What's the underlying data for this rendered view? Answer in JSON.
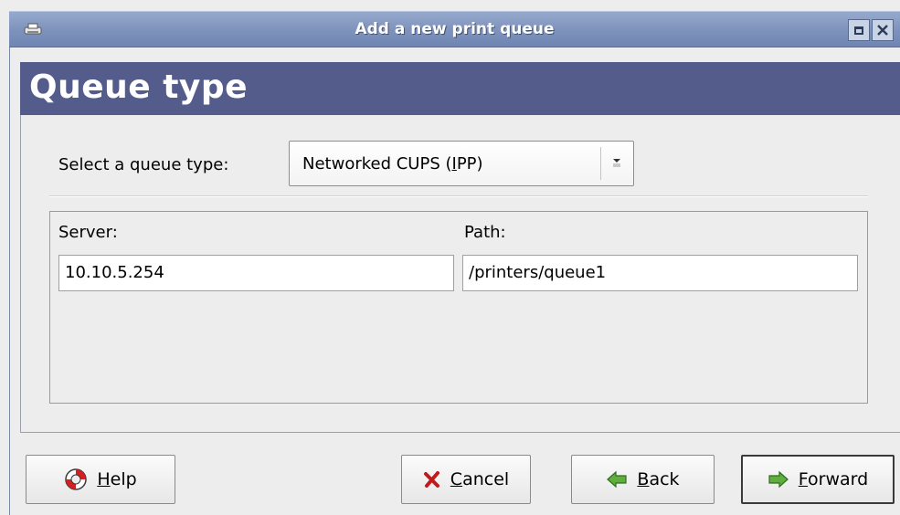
{
  "window": {
    "title": "Add a new print queue"
  },
  "header": {
    "title": "Queue type"
  },
  "queue_type": {
    "label": "Select a queue type:",
    "selected_prefix": "Networked CUPS (",
    "selected_mnemonic": "I",
    "selected_suffix": "PP)"
  },
  "server": {
    "label": "Server:",
    "value": "10.10.5.254"
  },
  "path": {
    "label": "Path:",
    "value": "/printers/queue1"
  },
  "buttons": {
    "help": {
      "mnemonic": "H",
      "rest": "elp"
    },
    "cancel": {
      "mnemonic": "C",
      "rest": "ancel"
    },
    "back": {
      "mnemonic": "B",
      "rest": "ack"
    },
    "forward": {
      "mnemonic": "F",
      "rest": "orward"
    }
  },
  "icons": {
    "app": "printer-icon",
    "maximize": "maximize-icon",
    "close": "close-icon",
    "combo": "dropdown-arrow-icon",
    "help": "lifebuoy-icon",
    "cancel": "red-x-icon",
    "back": "green-left-arrow-icon",
    "forward": "green-right-arrow-icon"
  },
  "colors": {
    "titlebar": "#7d92bb",
    "header": "#535c8a",
    "window_bg": "#ededed"
  }
}
